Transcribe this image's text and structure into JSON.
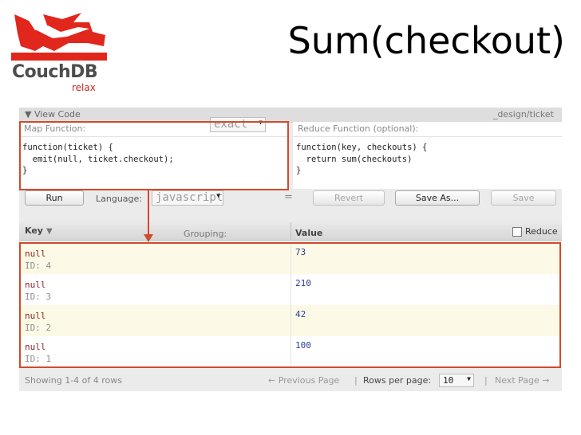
{
  "slide": {
    "title": "Sum(checkout)"
  },
  "logo": {
    "word": "CouchDB",
    "tagline": "relax"
  },
  "view_code": {
    "toggle_label": "▼ View Code",
    "design_doc": "_design/ticket",
    "map": {
      "label": "Map Function:",
      "code": "function(ticket) {\n  emit(null, ticket.checkout);\n}"
    },
    "reduce": {
      "label": "Reduce Function (optional):",
      "code": "function(key, checkouts) {\n  return sum(checkouts)\n}"
    }
  },
  "toolbar": {
    "run_label": "Run",
    "language_label": "Language:",
    "language_value": "javascript",
    "equals": "=",
    "revert_label": "Revert",
    "save_as_label": "Save As...",
    "save_label": "Save"
  },
  "table": {
    "key_header": "Key",
    "grouping_label": "Grouping:",
    "grouping_value": "exact",
    "value_header": "Value",
    "reduce_label": "Reduce",
    "reduce_checked": false,
    "rows": [
      {
        "key": "null",
        "id": "ID: 4",
        "value": "73"
      },
      {
        "key": "null",
        "id": "ID: 3",
        "value": "210"
      },
      {
        "key": "null",
        "id": "ID: 2",
        "value": "42"
      },
      {
        "key": "null",
        "id": "ID: 1",
        "value": "100"
      }
    ]
  },
  "pager": {
    "showing": "Showing 1-4 of 4 rows",
    "prev": "← Previous Page",
    "sep": "|",
    "rows_per_page_label": "Rows per page:",
    "rows_per_page_value": "10",
    "next": "Next Page →"
  },
  "colors": {
    "highlight": "#d24a2c",
    "logo_red": "#e1261c",
    "row_tint": "#fcfae6"
  }
}
